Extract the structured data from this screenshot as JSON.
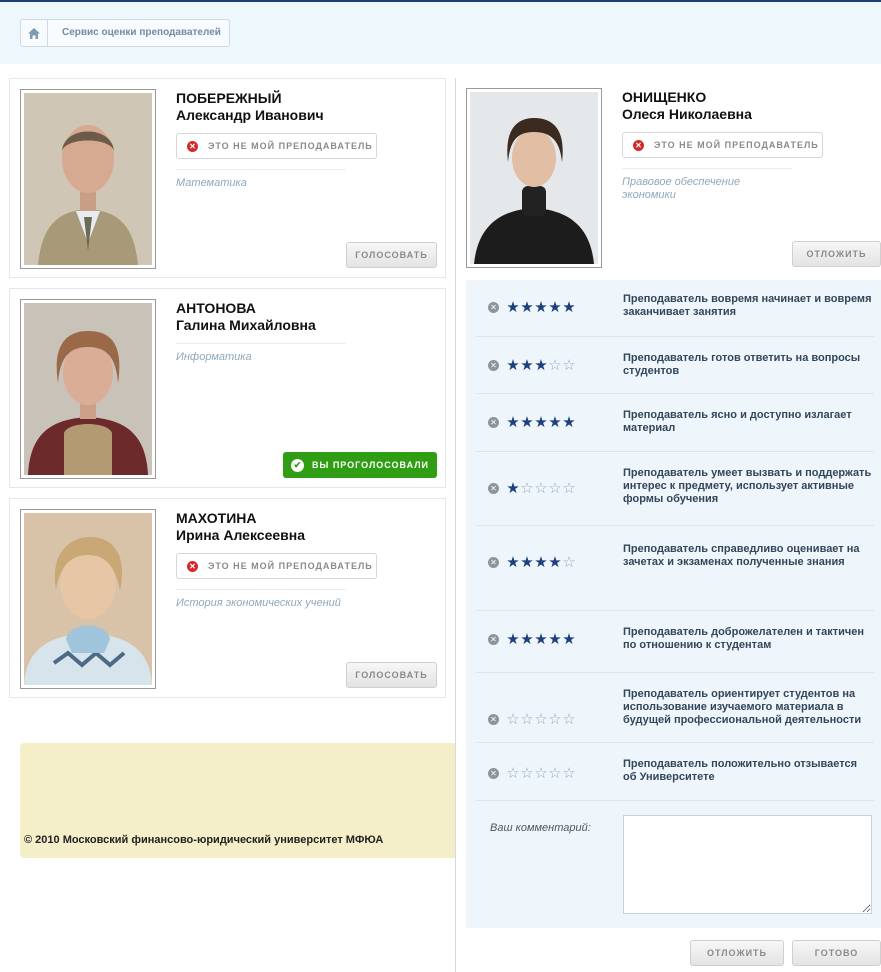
{
  "breadcrumb": {
    "label": "Сервис оценки преподавателей"
  },
  "teachers": [
    {
      "last_name": "ПОБЕРЕЖНЫЙ",
      "first_name": "Александр Иванович",
      "not_mine_label": "ЭТО НЕ МОЙ ПРЕПОДАВАТЕЛЬ",
      "subject": "Математика",
      "action_label": "ГОЛОСОВАТЬ"
    },
    {
      "last_name": "АНТОНОВА",
      "first_name": "Галина Михайловна",
      "subject": "Информатика",
      "action_label": "ВЫ ПРОГОЛОСОВАЛИ"
    },
    {
      "last_name": "МАХОТИНА",
      "first_name": "Ирина Алексеевна",
      "not_mine_label": "ЭТО НЕ МОЙ ПРЕПОДАВАТЕЛЬ",
      "subject": "История экономических учений",
      "action_label": "ГОЛОСОВАТЬ"
    }
  ],
  "selected_teacher": {
    "last_name": "ОНИЩЕНКО",
    "first_name": "Олеся Николаевна",
    "not_mine_label": "ЭТО НЕ МОЙ ПРЕПОДАВАТЕЛЬ",
    "subject": "Правовое обеспечение экономики",
    "postpone_label": "ОТЛОЖИТЬ"
  },
  "criteria": [
    {
      "text": "Преподаватель вовремя начинает и вовремя заканчивает занятия",
      "stars": 5
    },
    {
      "text": "Преподаватель готов ответить на вопросы студентов",
      "stars": 3
    },
    {
      "text": "Преподаватель ясно и доступно излагает материал",
      "stars": 5
    },
    {
      "text": "Преподаватель умеет вызвать и поддержать интерес к предмету, использует активные формы обучения",
      "stars": 1
    },
    {
      "text": "Преподаватель справедливо оценивает на зачетах и экзаменах полученные знания",
      "stars": 4
    },
    {
      "text": "Преподаватель доброжелателен и тактичен по отношению к студентам",
      "stars": 5
    },
    {
      "text": "Преподаватель ориентирует студентов на использование изучаемого материала в будущей профессиональной деятельности",
      "stars": 0
    },
    {
      "text": "Преподаватель положительно отзывается об Университете",
      "stars": 0
    }
  ],
  "max_stars": 5,
  "comment": {
    "label": "Ваш комментарий:",
    "value": ""
  },
  "actions": {
    "postpone_label": "ОТЛОЖИТЬ",
    "done_label": "ГОТОВО"
  },
  "footer": {
    "copyright": "© 2010 Московский финансово-юридический университет МФЮА"
  },
  "colors": {
    "accent": "#1d3f7a",
    "voted": "#2f9e14",
    "remove": "#d42a2a",
    "panel_bg": "#eef6fc",
    "footer_bg": "#f5efc9"
  }
}
